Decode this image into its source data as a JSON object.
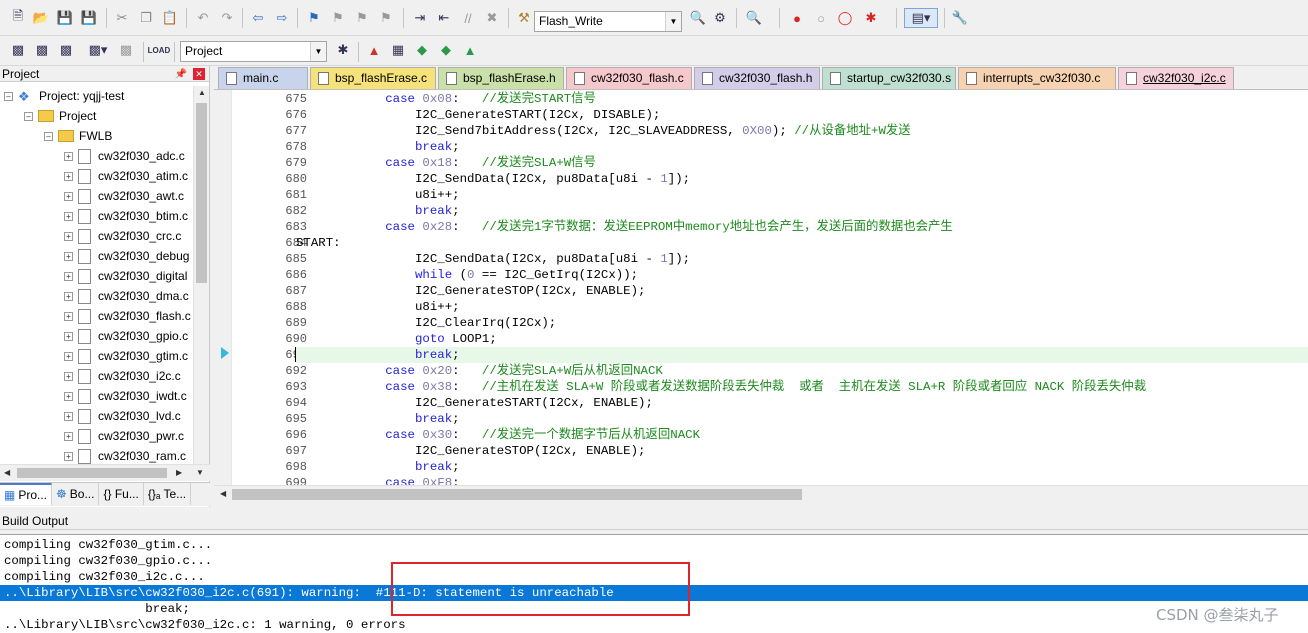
{
  "toolbar1": {
    "target_combo": "Flash_Write",
    "icons": [
      "new-file-icon",
      "open-folder-icon",
      "save-icon",
      "save-all-icon",
      "cut-icon",
      "copy-icon",
      "paste-icon",
      "undo-icon",
      "redo-icon",
      "nav-back-icon",
      "nav-forward-icon",
      "bookmark-icon",
      "bookmark-prev-icon",
      "bookmark-next-icon",
      "bookmark-clear-icon",
      "indent-icon",
      "unindent-icon",
      "comment-icon",
      "uncomment-icon",
      "find-in-files-icon",
      "debug-start-icon",
      "breakpoint-icon",
      "breakpoint-disable-icon",
      "breakpoint-kill-icon",
      "window-layout-icon",
      "settings-icon"
    ]
  },
  "toolbar2": {
    "project_combo": "Project"
  },
  "project_panel": {
    "title": "Project",
    "root": "Project: yqjj-test",
    "group": "Project",
    "folder": "FWLB",
    "files": [
      "cw32f030_adc.c",
      "cw32f030_atim.c",
      "cw32f030_awt.c",
      "cw32f030_btim.c",
      "cw32f030_crc.c",
      "cw32f030_debug",
      "cw32f030_digital",
      "cw32f030_dma.c",
      "cw32f030_flash.c",
      "cw32f030_gpio.c",
      "cw32f030_gtim.c",
      "cw32f030_i2c.c",
      "cw32f030_iwdt.c",
      "cw32f030_lvd.c",
      "cw32f030_pwr.c",
      "cw32f030_ram.c"
    ],
    "bottom_tabs": [
      "Pro...",
      "Bo...",
      "{} Fu...",
      "{}ₐ Te..."
    ]
  },
  "editor_tabs": [
    {
      "label": "main.c",
      "color": "#c8d4ec"
    },
    {
      "label": "bsp_flashErase.c",
      "color": "#f6e27a"
    },
    {
      "label": "bsp_flashErase.h",
      "color": "#c9e0a8"
    },
    {
      "label": "cw32f030_flash.c",
      "color": "#f5c8cc"
    },
    {
      "label": "cw32f030_flash.h",
      "color": "#d4cdea"
    },
    {
      "label": "startup_cw32f030.s",
      "color": "#bfe0d0"
    },
    {
      "label": "interrupts_cw32f030.c",
      "color": "#f6d2b0"
    },
    {
      "label": "cw32f030_i2c.c",
      "color": "#f6d2dc"
    }
  ],
  "code_lines": [
    {
      "n": "675",
      "html": "            <span class=\"kw\">case</span> <span class=\"num\">0x08</span>:   <span class=\"cm\">//发送完START信号</span>"
    },
    {
      "n": "676",
      "html": "                I2C_GenerateSTART(I2Cx, DISABLE);"
    },
    {
      "n": "677",
      "html": "                I2C_Send7bitAddress(I2Cx, I2C_SLAVEADDRESS, <span class=\"num\">0X00</span>); <span class=\"cm\">//从设备地址+W发送</span>"
    },
    {
      "n": "678",
      "html": "                <span class=\"kw\">break</span>;"
    },
    {
      "n": "679",
      "html": "            <span class=\"kw\">case</span> <span class=\"num\">0x18</span>:   <span class=\"cm\">//发送完SLA+W信号</span>"
    },
    {
      "n": "680",
      "html": "                I2C_SendData(I2Cx, pu8Data[u8i - <span class=\"num\">1</span>]);"
    },
    {
      "n": "681",
      "html": "                u8i++;"
    },
    {
      "n": "682",
      "html": "                <span class=\"kw\">break</span>;"
    },
    {
      "n": "683",
      "html": "            <span class=\"kw\">case</span> <span class=\"num\">0x28</span>:   <span class=\"cm\">//发送完1字节数据：发送EEPROM中memory地址也会产生，发送后面的数据也会产生</span>"
    },
    {
      "n": "684",
      "html": "START:"
    },
    {
      "n": "685",
      "html": "                I2C_SendData(I2Cx, pu8Data[u8i - <span class=\"num\">1</span>]);"
    },
    {
      "n": "686",
      "html": "                <span class=\"kw\">while</span> (<span class=\"num\">0</span> == I2C_GetIrq(I2Cx));"
    },
    {
      "n": "687",
      "html": "                I2C_GenerateSTOP(I2Cx, ENABLE);"
    },
    {
      "n": "688",
      "html": "                u8i++;"
    },
    {
      "n": "689",
      "html": "                I2C_ClearIrq(I2Cx);"
    },
    {
      "n": "690",
      "html": "                <span class=\"kw\">goto</span> LOOP1;"
    },
    {
      "n": "691",
      "html": "                <span class=\"kw\">break</span>;",
      "current": true
    },
    {
      "n": "692",
      "html": "            <span class=\"kw\">case</span> <span class=\"num\">0x20</span>:   <span class=\"cm\">//发送完SLA+W后从机返回NACK</span>"
    },
    {
      "n": "693",
      "html": "            <span class=\"kw\">case</span> <span class=\"num\">0x38</span>:   <span class=\"cm\">//主机在发送 SLA+W 阶段或者发送数据阶段丢失仲裁  或者  主机在发送 SLA+R 阶段或者回应 NACK 阶段丢失仲裁</span>"
    },
    {
      "n": "694",
      "html": "                I2C_GenerateSTART(I2Cx, ENABLE);"
    },
    {
      "n": "695",
      "html": "                <span class=\"kw\">break</span>;"
    },
    {
      "n": "696",
      "html": "            <span class=\"kw\">case</span> <span class=\"num\">0x30</span>:   <span class=\"cm\">//发送完一个数据字节后从机返回NACK</span>"
    },
    {
      "n": "697",
      "html": "                I2C_GenerateSTOP(I2Cx, ENABLE);"
    },
    {
      "n": "698",
      "html": "                <span class=\"kw\">break</span>;"
    },
    {
      "n": "699",
      "html": "            <span class=\"kw\">case</span> <span class=\"num\">0xF8</span>:"
    }
  ],
  "build_output": {
    "title": "Build Output",
    "lines": [
      {
        "text": "compiling cw32f030_gtim.c...",
        "selected": false
      },
      {
        "text": "compiling cw32f030_gpio.c...",
        "selected": false
      },
      {
        "text": "compiling cw32f030_i2c.c...",
        "selected": false
      },
      {
        "text": "..\\Library\\LIB\\src\\cw32f030_i2c.c(691): warning:  #111-D: statement is unreachable",
        "selected": true
      },
      {
        "text": "                   break;",
        "selected": false
      },
      {
        "text": "..\\Library\\LIB\\src\\cw32f030_i2c.c: 1 warning, 0 errors",
        "selected": false
      }
    ]
  },
  "watermark": "CSDN @叁柒丸子"
}
